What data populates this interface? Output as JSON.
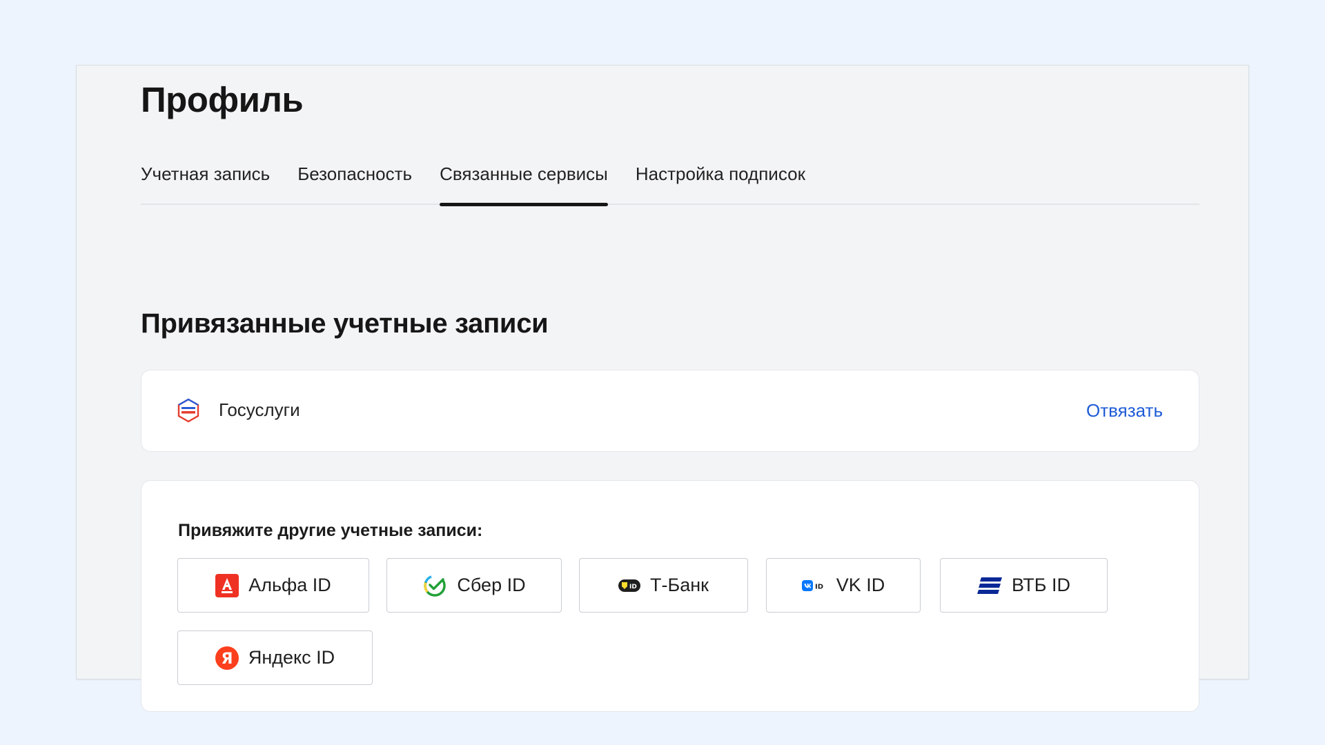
{
  "page": {
    "title": "Профиль"
  },
  "tabs": [
    {
      "label": "Учетная запись",
      "active": false
    },
    {
      "label": "Безопасность",
      "active": false
    },
    {
      "label": "Связанные сервисы",
      "active": true
    },
    {
      "label": "Настройка подписок",
      "active": false
    }
  ],
  "linked": {
    "title": "Привязанные учетные записи",
    "items": [
      {
        "name": "Госуслуги",
        "icon": "gosuslugi-icon",
        "action": "Отвязать"
      }
    ]
  },
  "other": {
    "label": "Привяжите другие учетные записи:",
    "providers": [
      {
        "label": "Альфа ID",
        "icon": "alfa-icon"
      },
      {
        "label": "Сбер ID",
        "icon": "sber-icon"
      },
      {
        "label": "Т-Банк",
        "icon": "tbank-icon"
      },
      {
        "label": "VK ID",
        "icon": "vk-icon"
      },
      {
        "label": "ВТБ ID",
        "icon": "vtb-icon"
      },
      {
        "label": "Яндекс ID",
        "icon": "yandex-icon"
      }
    ]
  },
  "colors": {
    "background": "#edf4fd",
    "panel": "#f3f4f6",
    "link": "#1e5bd6",
    "alfa": "#ef3124",
    "vtb": "#0a2896",
    "yandex": "#fc3f1d",
    "vk": "#0077ff",
    "sber": "#21a038"
  }
}
